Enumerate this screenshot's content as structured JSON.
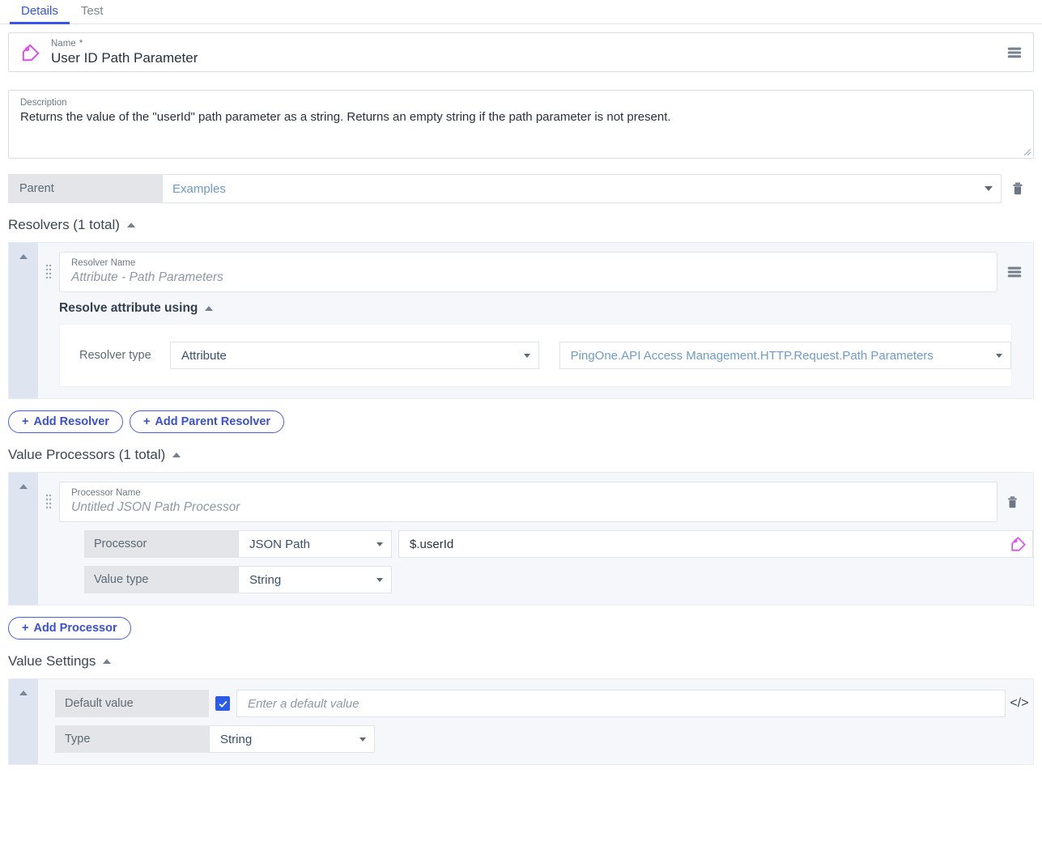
{
  "tabs": [
    {
      "label": "Details",
      "active": true
    },
    {
      "label": "Test",
      "active": false
    }
  ],
  "name_field": {
    "label": "Name",
    "required_marker": "*",
    "value": "User ID Path Parameter",
    "icon": "tag-icon",
    "menu_icon": "hamburger-menu-icon"
  },
  "description_field": {
    "label": "Description",
    "value": "Returns the value of the \"userId\" path parameter as a string. Returns an empty string if the path parameter is not present."
  },
  "parent_row": {
    "label": "Parent",
    "value": "Examples",
    "delete_icon": "trash-icon"
  },
  "resolvers_section": {
    "heading": "Resolvers (1 total)",
    "resolver": {
      "name_label": "Resolver Name",
      "name_placeholder": "Attribute - Path Parameters",
      "subheading": "Resolve attribute using",
      "type_label": "Resolver type",
      "type_value": "Attribute",
      "source_value": "PingOne.API Access Management.HTTP.Request.Path Parameters"
    },
    "add_resolver_label": "Add Resolver",
    "add_parent_resolver_label": "Add Parent Resolver",
    "plus": "+"
  },
  "processors_section": {
    "heading": "Value Processors (1 total)",
    "processor": {
      "name_label": "Processor Name",
      "name_placeholder": "Untitled JSON Path Processor",
      "processor_label": "Processor",
      "processor_value": "JSON Path",
      "expression_value": "$.userId",
      "value_type_label": "Value type",
      "value_type_value": "String"
    },
    "add_processor_label": "Add Processor",
    "plus": "+"
  },
  "value_settings_section": {
    "heading": "Value Settings",
    "default_value_label": "Default value",
    "default_value_checked": true,
    "default_value_placeholder": "Enter a default value",
    "type_label": "Type",
    "type_value": "String",
    "code_icon": "code-icon"
  },
  "colors": {
    "accent_blue": "#3355e8",
    "link_blue": "#6f9ac9",
    "tag_magenta": "#e040fb",
    "rail_blue": "#dfe5f0",
    "card_bg": "#f5f7fb",
    "grey_label": "#e3e5e8"
  }
}
